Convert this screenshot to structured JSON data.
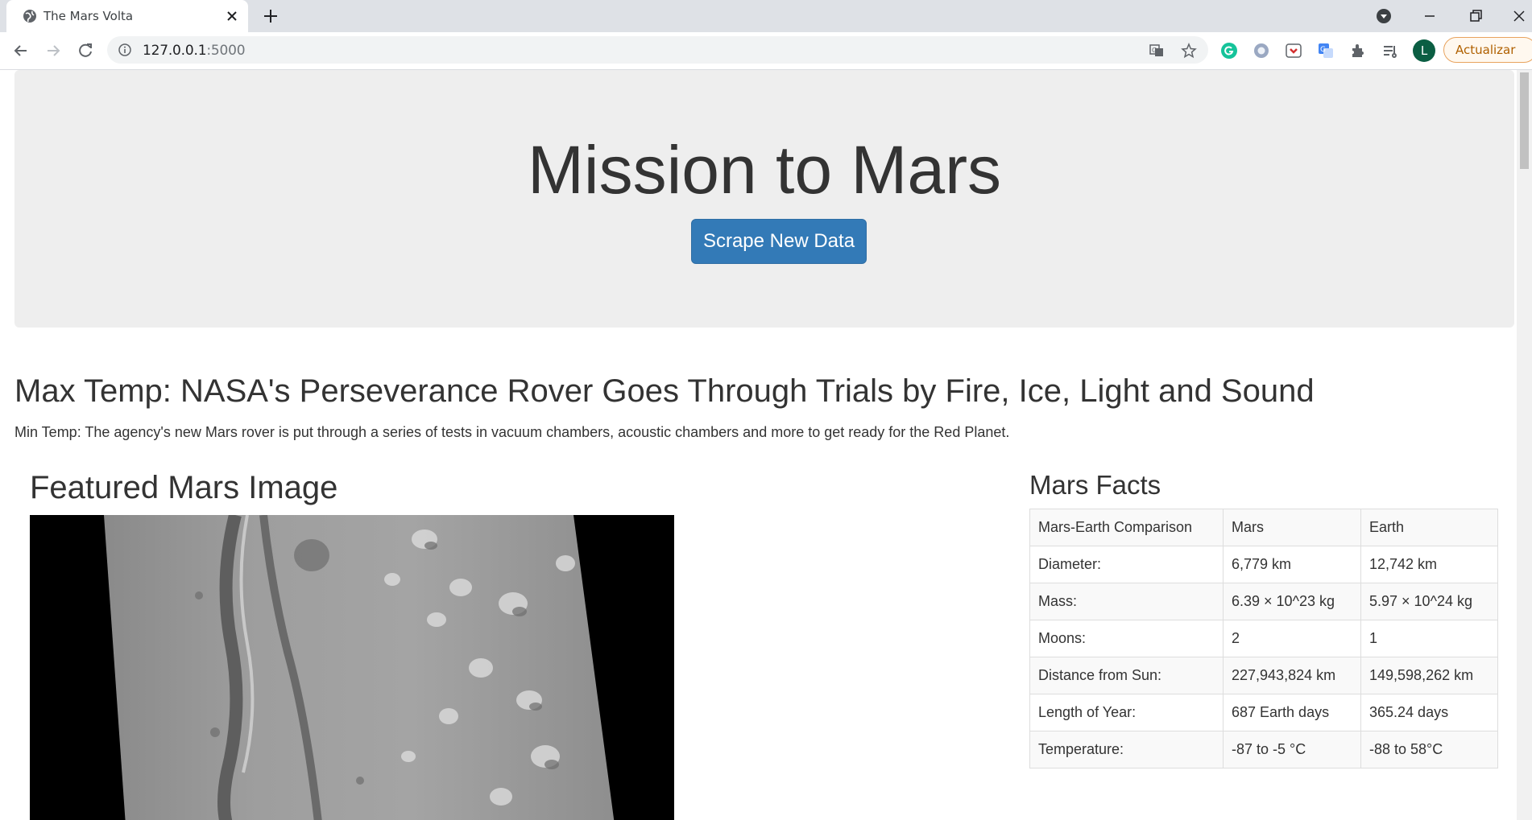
{
  "browser": {
    "tab_title": "The Mars Volta",
    "url_host": "127.0.0.1",
    "url_port": ":5000",
    "avatar_letter": "L",
    "update_label": "Actualizar"
  },
  "page": {
    "title": "Mission to Mars",
    "scrape_button": "Scrape New Data",
    "news_title": "Max Temp: NASA's Perseverance Rover Goes Through Trials by Fire, Ice, Light and Sound",
    "news_paragraph": "Min Temp: The agency's new Mars rover is put through a series of tests in vacuum chambers, acoustic chambers and more to get ready for the Red Planet.",
    "featured_title": "Featured Mars Image",
    "facts_title": "Mars Facts",
    "facts_header": [
      "Mars-Earth Comparison",
      "Mars",
      "Earth"
    ],
    "facts_rows": [
      [
        "Diameter:",
        "6,779 km",
        "12,742 km"
      ],
      [
        "Mass:",
        "6.39 × 10^23 kg",
        "5.97 × 10^24 kg"
      ],
      [
        "Moons:",
        "2",
        "1"
      ],
      [
        "Distance from Sun:",
        "227,943,824 km",
        "149,598,262 km"
      ],
      [
        "Length of Year:",
        "687 Earth days",
        "365.24 days"
      ],
      [
        "Temperature:",
        "-87 to -5 °C",
        "-88 to 58°C"
      ]
    ]
  },
  "colors": {
    "button": "#337ab7",
    "jumbotron": "#eeeeee",
    "text": "#333333"
  }
}
